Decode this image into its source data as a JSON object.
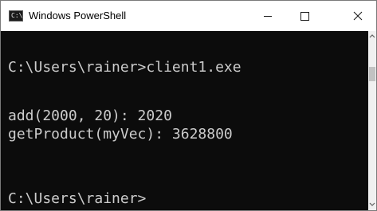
{
  "window": {
    "title": "Windows PowerShell",
    "icon": "powershell-console-icon",
    "icon_glyph": "C:\\"
  },
  "controls": {
    "minimize_icon": "minimize-icon",
    "maximize_icon": "maximize-icon",
    "close_icon": "close-icon"
  },
  "console": {
    "lines": [
      "C:\\Users\\rainer>client1.exe",
      "add(2000, 20): 2020",
      "getProduct(myVec): 3628800",
      "C:\\Users\\rainer>"
    ],
    "background_color": "#0c0c0c",
    "text_color": "#cccccc"
  }
}
